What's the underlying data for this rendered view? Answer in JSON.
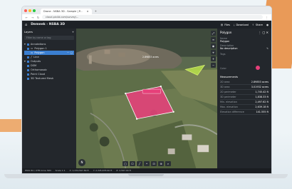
{
  "browser": {
    "tab_title": "Drone - NSBA 3D - Sample | P...",
    "url": "cloud.pix4d.com/survey/..."
  },
  "app": {
    "title": "Demeek - NSBA 3D",
    "actions": [
      "Files",
      "Download",
      "Share"
    ]
  },
  "layers": {
    "title": "Layers",
    "filter_placeholder": "Filter by name or tag",
    "annotations_label": "Annotations",
    "items": [
      {
        "label": "Polygon 1",
        "selected": false
      },
      {
        "label": "Polygon",
        "selected": true
      },
      {
        "label": "Line",
        "selected": false
      }
    ],
    "outputs_label": "Outputs",
    "outputs": [
      "DSM",
      "Orthomosaic",
      "Point Cloud",
      "3D Textured Mesh"
    ]
  },
  "inspector": {
    "title": "Polygon",
    "name_label": "Name",
    "name_value": "Polygon",
    "description_label": "Description",
    "description_value": "No description",
    "tags_label": "Tags",
    "color_label": "Color",
    "color_value": "#e6407a",
    "measurements_label": "Measurements",
    "measurements": [
      {
        "k": "2D area",
        "v": "2.89853 acres"
      },
      {
        "k": "3D area",
        "v": "3.01932 acres"
      },
      {
        "k": "2D perimeter",
        "v": "1,745.42 ft"
      },
      {
        "k": "3D perimeter",
        "v": "1,838.33 ft"
      },
      {
        "k": "Min. elevation",
        "v": "2,497.62 ft"
      },
      {
        "k": "Max. elevation",
        "v": "2,639.18 ft"
      },
      {
        "k": "Elevation difference",
        "v": "141.555 ft"
      }
    ]
  },
  "viewport": {
    "area_label": "2.89853 acres"
  },
  "status_bar": {
    "items": [
      "WGS 84 / UTM zone 32N",
      "Scale 1:1",
      "X: 1,234,567.89 ft",
      "Y: 2,345,678.90 ft",
      "Z: 2,567.04 ft"
    ]
  },
  "colors": {
    "polygon_fill": "#e6407a",
    "line_fill": "#b9e04a",
    "accent": "#3b7fd1"
  }
}
